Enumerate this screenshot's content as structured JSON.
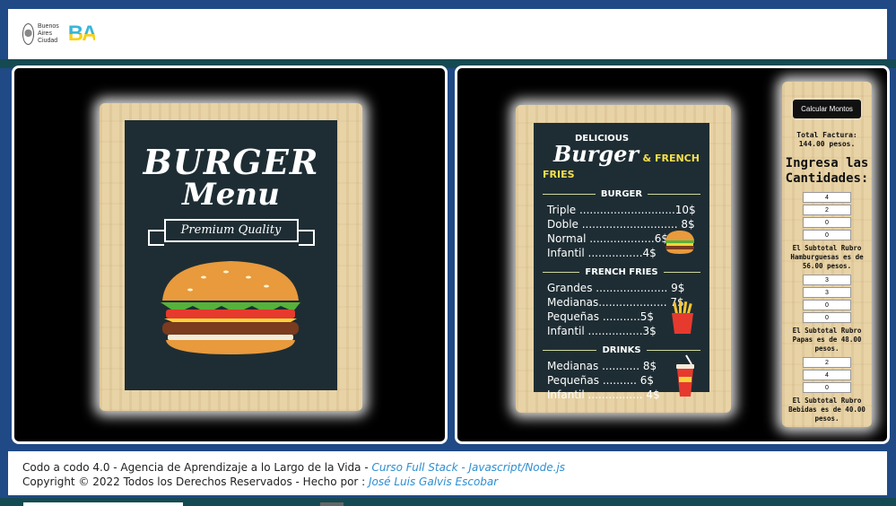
{
  "header": {
    "city_logo_text": [
      "Buenos",
      "Aires",
      "Ciudad"
    ],
    "ba_logo": "BA"
  },
  "left_menu": {
    "title": "BURGER",
    "subtitle": "Menu",
    "ribbon": "Premium Quality"
  },
  "right_menu": {
    "kicker": "DELICIOUS",
    "title": "Burger",
    "title_suffix": "& FRENCH FRIES",
    "sections": [
      {
        "heading": "BURGER",
        "items": [
          "Triple ............................10$",
          "Doble ............................ 8$",
          "Normal ...................6$",
          "Infantil ................4$"
        ]
      },
      {
        "heading": "FRENCH FRIES",
        "items": [
          "Grandes ..................... 9$",
          "Medianas.................... 7$",
          "Pequeñas ...........5$",
          "Infantil ................3$"
        ]
      },
      {
        "heading": "DRINKS",
        "items": [
          "Medianas ........... 8$",
          "Pequeñas .......... 6$",
          "Infantil ................ 4$"
        ]
      }
    ]
  },
  "calculator": {
    "button_label": "Calcular Montos",
    "total_text": "Total Factura: 144.00 pesos.",
    "heading": "Ingresa las Cantidades:",
    "burger_qty": [
      "4",
      "2",
      "0",
      "0"
    ],
    "burger_subtotal": "El Subtotal Rubro Hamburguesas es de 56.00 pesos.",
    "fries_qty": [
      "3",
      "3",
      "0",
      "0"
    ],
    "fries_subtotal": "El Subtotal Rubro Papas es de 48.00 pesos.",
    "drinks_qty": [
      "2",
      "4",
      "0"
    ],
    "drinks_subtotal": "El Subtotal Rubro Bebidas es de 40.00 pesos."
  },
  "footer": {
    "line1_text": "Codo a codo 4.0 - Agencia de Aprendizaje a lo Largo de la Vida - ",
    "line1_link": "Curso Full Stack - Javascript/Node.js",
    "line2_text": "Copyright © 2022 Todos los Derechos Reservados - Hecho por : ",
    "line2_link": "José Luis Galvis Escobar"
  }
}
